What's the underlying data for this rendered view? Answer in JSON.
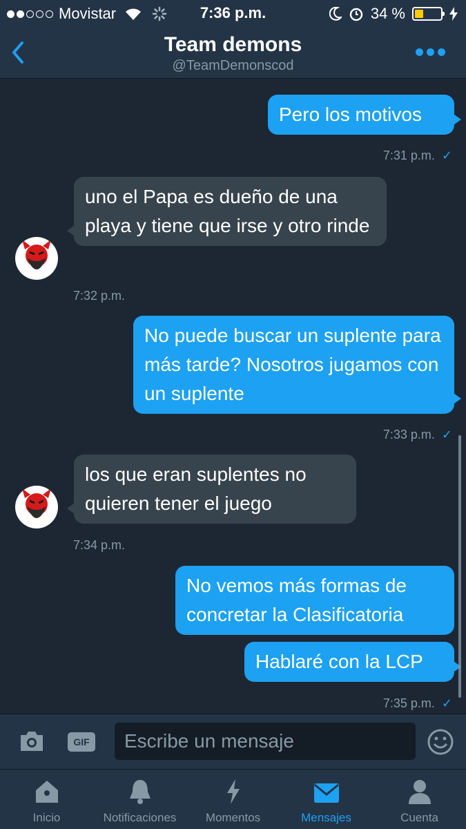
{
  "status_bar": {
    "carrier": "Movistar",
    "time": "7:36 p.m.",
    "battery": "34 %",
    "battery_level": 0.34
  },
  "header": {
    "title": "Team demons",
    "handle": "@TeamDemonscod"
  },
  "messages": [
    {
      "id": "m1",
      "dir": "out",
      "text": "Pero los motivos",
      "time": "7:31 p.m."
    },
    {
      "id": "m2",
      "dir": "in",
      "text": "uno el Papa es dueño de una playa y tiene que irse y otro rinde",
      "time": "7:32 p.m."
    },
    {
      "id": "m3",
      "dir": "out",
      "text": "No puede buscar un suplente para más tarde? Nosotros jugamos con un suplente",
      "time": "7:33 p.m."
    },
    {
      "id": "m4",
      "dir": "in",
      "text": "los que eran suplentes no quieren tener el juego",
      "time": "7:34 p.m."
    },
    {
      "id": "m5",
      "dir": "out",
      "text": "No vemos más formas de concretar la Clasificatoria",
      "time": ""
    },
    {
      "id": "m6",
      "dir": "out",
      "text": "Hablaré con la LCP",
      "time": "7:35 p.m."
    }
  ],
  "compose": {
    "placeholder": "Escribe un mensaje",
    "gif_label": "GIF"
  },
  "tabs": [
    {
      "label": "Inicio",
      "icon": "home-icon",
      "active": false
    },
    {
      "label": "Notificaciones",
      "icon": "bell-icon",
      "active": false
    },
    {
      "label": "Momentos",
      "icon": "lightning-icon",
      "active": false
    },
    {
      "label": "Mensajes",
      "icon": "envelope-icon",
      "active": true
    },
    {
      "label": "Cuenta",
      "icon": "person-icon",
      "active": false
    }
  ],
  "colors": {
    "background": "#1c2733",
    "bar": "#243447",
    "accent": "#1da1f2",
    "incoming_bubble": "#38444d",
    "muted": "#8899a6"
  }
}
